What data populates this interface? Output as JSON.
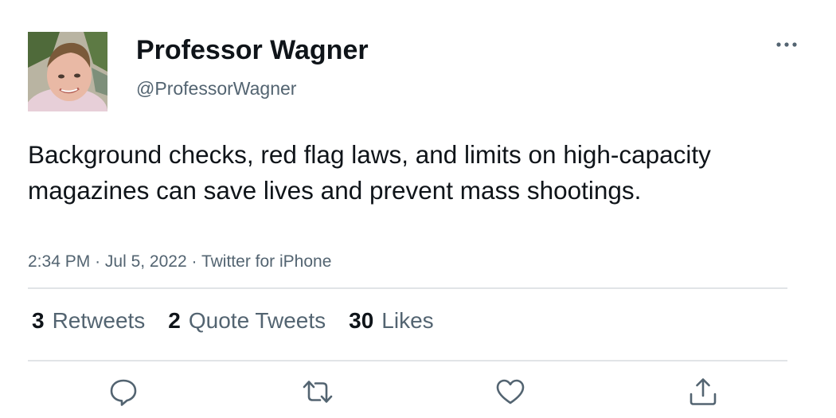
{
  "tweet": {
    "author": {
      "display_name": "Professor Wagner",
      "handle": "@ProfessorWagner"
    },
    "text": "Background checks, red flag laws, and limits on high-capacity magazines can save lives and prevent mass shootings.",
    "meta": {
      "time": "2:34 PM",
      "separator_1": "·",
      "date": "Jul 5, 2022",
      "separator_2": "·",
      "source": "Twitter for iPhone"
    },
    "stats": {
      "retweets_count": "3",
      "retweets_label": "Retweets",
      "quotes_count": "2",
      "quotes_label": "Quote Tweets",
      "likes_count": "30",
      "likes_label": "Likes"
    },
    "actions": {
      "reply_icon": "reply-icon",
      "retweet_icon": "retweet-icon",
      "like_icon": "heart-icon",
      "share_icon": "share-icon"
    },
    "colors": {
      "text_primary": "#0f1419",
      "text_secondary": "#536471",
      "divider": "#e1e4e7",
      "icon": "#536471"
    }
  }
}
